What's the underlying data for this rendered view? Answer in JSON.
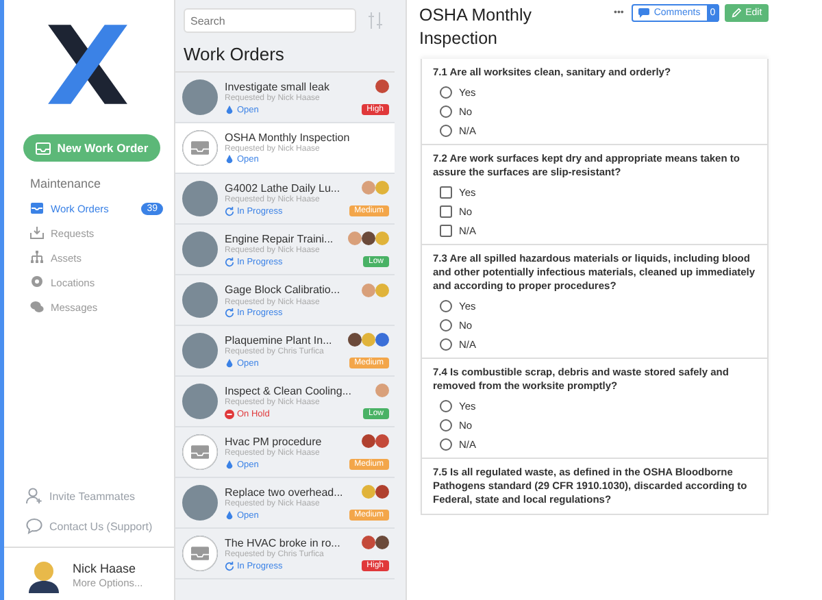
{
  "sidebar": {
    "new_button": "New Work Order",
    "section": "Maintenance",
    "items": [
      {
        "label": "Work Orders",
        "kind": "inbox",
        "selected": true,
        "count": "39"
      },
      {
        "label": "Requests",
        "kind": "tray",
        "selected": false
      },
      {
        "label": "Assets",
        "kind": "hierarchy",
        "selected": false
      },
      {
        "label": "Locations",
        "kind": "pin",
        "selected": false
      },
      {
        "label": "Messages",
        "kind": "chat",
        "selected": false
      }
    ],
    "footer_links": [
      {
        "label": "Invite Teammates",
        "kind": "person"
      },
      {
        "label": "Contact Us (Support)",
        "kind": "bubble"
      }
    ],
    "user": {
      "name": "Nick Haase",
      "subtitle": "More Options..."
    }
  },
  "list": {
    "search": {
      "placeholder": "Search"
    },
    "title": "Work Orders",
    "items": [
      {
        "title": "Investigate small leak",
        "requester": "Requested by Nick Haase",
        "status": {
          "text": "Open",
          "kind": "open"
        },
        "priority": "High",
        "kind": "photo",
        "assignees": [
          {
            "color": "#c44a3a"
          }
        ],
        "selected": false
      },
      {
        "title": "OSHA Monthly Inspection",
        "requester": "Requested by Nick Haase",
        "status": {
          "text": "Open",
          "kind": "open"
        },
        "kind": "inbox",
        "selected": true
      },
      {
        "title": "G4002 Lathe Daily Lu...",
        "requester": "Requested by Nick Haase",
        "status": {
          "text": "In Progress",
          "kind": "progress"
        },
        "priority": "Medium",
        "kind": "photo",
        "assignees": [
          {
            "color": "#d9a07a"
          },
          {
            "color": "#e0b33a"
          }
        ],
        "selected": false
      },
      {
        "title": "Engine Repair Traini...",
        "requester": "Requested by Nick Haase",
        "status": {
          "text": "In Progress",
          "kind": "progress"
        },
        "priority": "Low",
        "kind": "photo",
        "assignees": [
          {
            "color": "#d9a07a"
          },
          {
            "color": "#6b4a3a"
          },
          {
            "color": "#e0b33a"
          }
        ],
        "selected": false
      },
      {
        "title": "Gage Block Calibratio...",
        "requester": "Requested by Nick Haase",
        "status": {
          "text": "In Progress",
          "kind": "progress"
        },
        "kind": "photo",
        "assignees": [
          {
            "color": "#d9a07a"
          },
          {
            "color": "#e0b33a"
          }
        ],
        "selected": false
      },
      {
        "title": "Plaquemine Plant In...",
        "requester": "Requested by Chris Turfica",
        "status": {
          "text": "Open",
          "kind": "open"
        },
        "priority": "Medium",
        "kind": "photo",
        "assignees": [
          {
            "color": "#6b4a3a"
          },
          {
            "color": "#e0b33a"
          },
          {
            "color": "#3a6fd8"
          }
        ],
        "selected": false
      },
      {
        "title": "Inspect & Clean Cooling...",
        "requester": "Requested by Nick Haase",
        "status": {
          "text": "On Hold",
          "kind": "hold"
        },
        "priority": "Low",
        "kind": "photo",
        "assignees": [
          {
            "color": "#d9a07a"
          }
        ],
        "selected": false
      },
      {
        "title": "Hvac PM procedure",
        "requester": "Requested by Nick Haase",
        "status": {
          "text": "Open",
          "kind": "open"
        },
        "priority": "Medium",
        "kind": "inbox",
        "assignees": [
          {
            "color": "#b0402e"
          },
          {
            "color": "#c44a3a"
          }
        ],
        "selected": false
      },
      {
        "title": "Replace two overhead...",
        "requester": "Requested by Nick Haase",
        "status": {
          "text": "Open",
          "kind": "open"
        },
        "priority": "Medium",
        "kind": "photo",
        "assignees": [
          {
            "color": "#e0b33a"
          },
          {
            "color": "#b0402e"
          }
        ],
        "selected": false
      },
      {
        "title": "The HVAC broke in ro...",
        "requester": "Requested by Chris Turfica",
        "status": {
          "text": "In Progress",
          "kind": "progress"
        },
        "priority": "High",
        "kind": "inbox",
        "assignees": [
          {
            "color": "#c44a3a"
          },
          {
            "color": "#6b4a3a"
          }
        ],
        "selected": false
      }
    ]
  },
  "detail": {
    "title": "OSHA Monthly Inspection",
    "more": "•••",
    "comments": "Comments",
    "comments_count": "0",
    "edit": "Edit",
    "questions": [
      {
        "text": "7.1 Are all worksites clean, sanitary and orderly?",
        "kind": "radio",
        "options": [
          {
            "label": "Yes",
            "checked": false
          },
          {
            "label": "No",
            "checked": false
          },
          {
            "label": "N/A",
            "checked": false
          }
        ]
      },
      {
        "text": "7.2 Are work surfaces kept dry and appropriate means taken to assure the surfaces are slip-resistant?",
        "kind": "checkbox",
        "options": [
          {
            "label": "Yes",
            "checked": false
          },
          {
            "label": "No",
            "checked": false
          },
          {
            "label": "N/A",
            "checked": false
          }
        ]
      },
      {
        "text": "7.3 Are all spilled hazardous materials or liquids, including blood and other potentially infectious materials, cleaned up immediately and according to proper procedures?",
        "kind": "radio",
        "options": [
          {
            "label": "Yes",
            "checked": false
          },
          {
            "label": "No",
            "checked": false
          },
          {
            "label": "N/A",
            "checked": false
          }
        ]
      },
      {
        "text": "7.4 Is combustible scrap, debris and waste stored safely and removed from the worksite promptly?",
        "kind": "radio",
        "options": [
          {
            "label": "Yes",
            "checked": false
          },
          {
            "label": "No",
            "checked": false
          },
          {
            "label": "N/A",
            "checked": false
          }
        ]
      },
      {
        "text": "7.5 Is all regulated waste, as defined in the OSHA Bloodborne Pathogens standard (29 CFR 1910.1030), discarded according to Federal, state and local regulations?"
      }
    ]
  }
}
